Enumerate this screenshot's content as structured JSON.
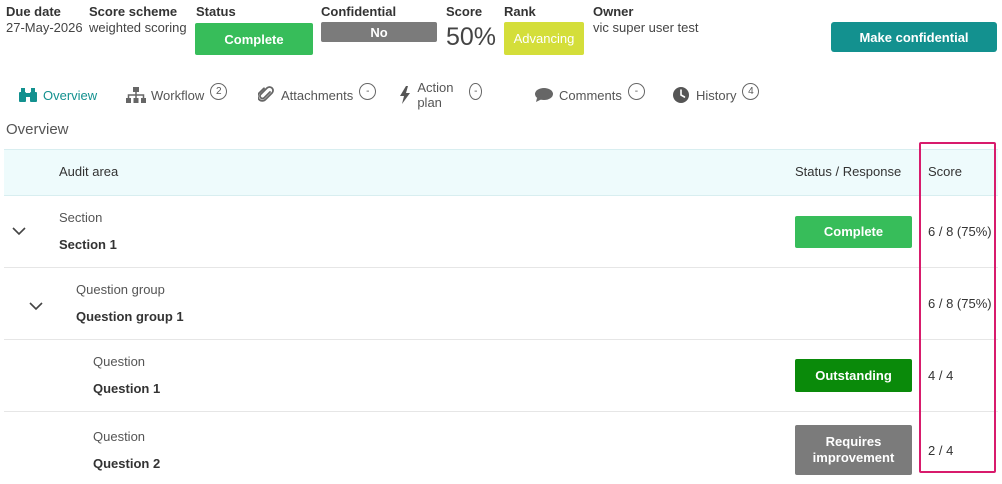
{
  "header": {
    "due_date_label": "Due date",
    "due_date_value": "27-May-2026",
    "score_scheme_label": "Score scheme",
    "score_scheme_value": "weighted scoring",
    "status_label": "Status",
    "status_value": "Complete",
    "confidential_label": "Confidential",
    "confidential_value": "No",
    "score_label": "Score",
    "score_value": "50%",
    "rank_label": "Rank",
    "rank_value": "Advancing",
    "owner_label": "Owner",
    "owner_value": "vic super user test",
    "make_confidential_label": "Make confidential"
  },
  "tabs": [
    {
      "label": "Overview",
      "icon": "binoculars-icon",
      "count": ""
    },
    {
      "label": "Workflow",
      "icon": "sitemap-icon",
      "count": "2"
    },
    {
      "label": "Attachments",
      "icon": "paperclip-icon",
      "count": "-"
    },
    {
      "label": "Action plan",
      "icon": "lightning-icon",
      "count": "-"
    },
    {
      "label": "Comments",
      "icon": "comment-icon",
      "count": "-"
    },
    {
      "label": "History",
      "icon": "clock-icon",
      "count": "4"
    }
  ],
  "section_title": "Overview",
  "table": {
    "col_area": "Audit area",
    "col_status": "Status / Response",
    "col_score": "Score",
    "rows": [
      {
        "type": "Section",
        "name": "Section 1",
        "response": "Complete",
        "score": "6 / 8 (75%)"
      },
      {
        "type": "Question group",
        "name": "Question group 1",
        "response": "",
        "score": "6 / 8 (75%)"
      },
      {
        "type": "Question",
        "name": "Question 1",
        "response": "Outstanding",
        "score": "4 / 4"
      },
      {
        "type": "Question",
        "name": "Question 2",
        "response": "Requires improvement",
        "score": "2 / 4"
      }
    ]
  },
  "colors": {
    "complete": "#37bd5a",
    "outstanding": "#0a8a0a",
    "requires_improvement": "#7b7b7b",
    "accent": "#13918f",
    "rank": "#d4de3a",
    "highlight": "#d81b6c"
  }
}
